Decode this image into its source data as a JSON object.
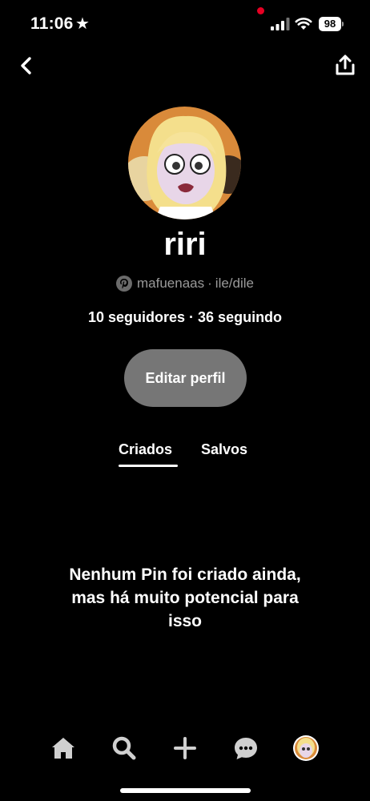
{
  "status_bar": {
    "time": "11:06",
    "battery": "98",
    "icons": [
      "star-icon",
      "signal-icon",
      "wifi-icon",
      "battery-icon"
    ]
  },
  "header": {
    "back_icon": "chevron-left-icon",
    "share_icon": "share-icon"
  },
  "profile": {
    "name": "riri",
    "username": "mafuenaas",
    "separator": "·",
    "pronouns": "ile/dile",
    "followers": "10 seguidores",
    "stats_separator": "·",
    "following": "36 seguindo",
    "edit_button_label": "Editar perfil"
  },
  "tabs": [
    {
      "label": "Criados",
      "active": true
    },
    {
      "label": "Salvos",
      "active": false
    }
  ],
  "empty_state": {
    "message": "Nenhum Pin foi criado ainda, mas há muito potencial para isso"
  },
  "bottom_nav": {
    "items": [
      "home-icon",
      "search-icon",
      "plus-icon",
      "chat-icon",
      "profile-avatar"
    ],
    "messages_has_notification": true
  },
  "colors": {
    "background": "#000000",
    "button_bg": "#767676",
    "muted_text": "#9a9a9a",
    "notification": "#e60023"
  }
}
